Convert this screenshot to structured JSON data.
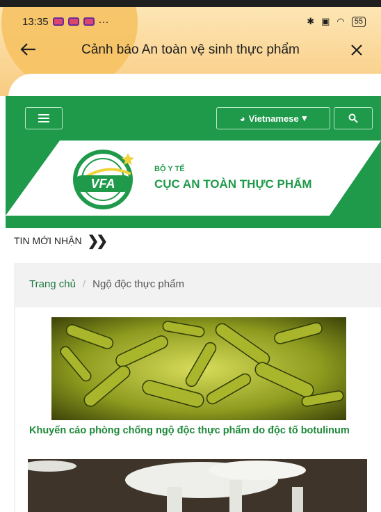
{
  "status_bar": {
    "time": "13:35",
    "extra": "···",
    "battery": "55",
    "icons": [
      "notification-icon",
      "notification-icon",
      "notification-icon",
      "bluetooth-icon",
      "vibrate-icon",
      "wifi-icon",
      "battery-icon"
    ]
  },
  "app_bar": {
    "title": "Cảnh báo An toàn vệ sinh thực phẩm",
    "back_icon": "back-arrow-icon",
    "close_icon": "close-icon"
  },
  "site_header": {
    "language_label": "Vietnamese",
    "brand_color": "#1e9a4a",
    "logo": {
      "abbr": "VFA",
      "line1": "BỘ Y TẾ",
      "line2": "CỤC AN TOÀN THỰC PHẨM"
    }
  },
  "ticker": {
    "label": "TIN MỚI NHẬN"
  },
  "breadcrumb": {
    "home": "Trang chủ",
    "separator": "/",
    "current": "Ngộ độc thực phẩm"
  },
  "articles": [
    {
      "title": "Khuyến cáo phòng chống ngộ độc thực phẩm do độc tố botulinum",
      "image": "bacteria-image"
    },
    {
      "image": "mushroom-image"
    }
  ]
}
